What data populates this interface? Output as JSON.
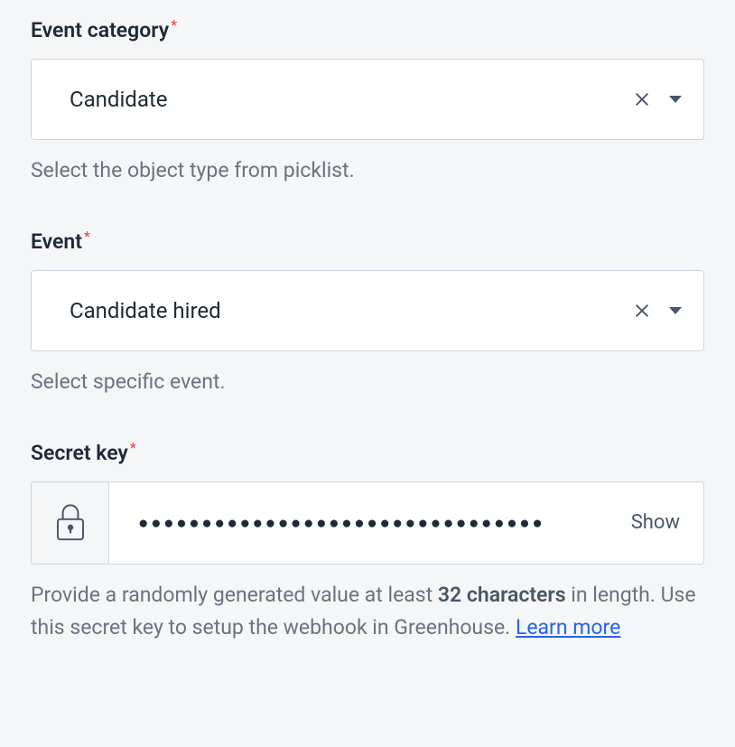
{
  "eventCategory": {
    "label": "Event category",
    "value": "Candidate",
    "helpText": "Select the object type from picklist."
  },
  "event": {
    "label": "Event",
    "value": "Candidate hired",
    "helpText": "Select specific event."
  },
  "secretKey": {
    "label": "Secret key",
    "maskedValue": "●●●●●●●●●●●●●●●●●●●●●●●●●●●●●●●●",
    "showLabel": "Show",
    "helpTextPrefix": "Provide a randomly generated value at least ",
    "helpTextBold": "32 characters",
    "helpTextSuffix": " in length. Use this secret key to setup the webhook in Greenhouse. ",
    "learnMoreLabel": "Learn more"
  },
  "requiredMark": "*"
}
